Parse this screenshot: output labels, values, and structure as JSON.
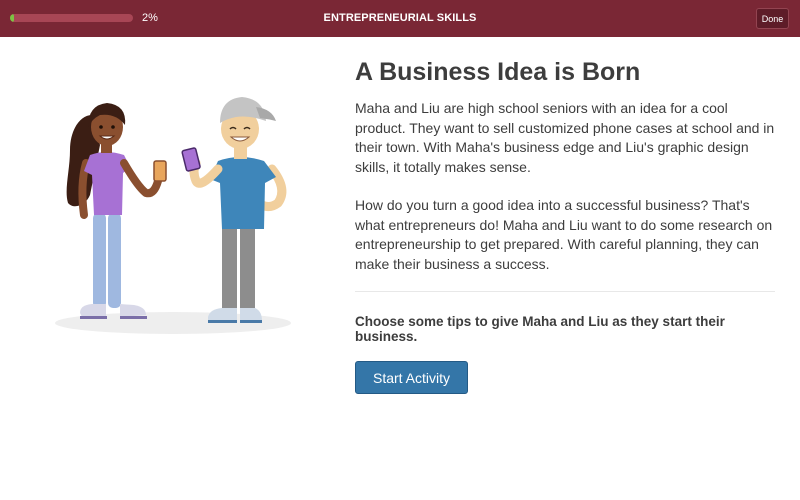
{
  "header": {
    "progress_percent_label": "2%",
    "progress_fraction": 0.02,
    "title": "ENTREPRENEURIAL SKILLS",
    "done_label": "Done"
  },
  "main": {
    "heading": "A Business Idea is Born",
    "paragraph1": "Maha and Liu are high school seniors with an idea for a cool product. They want to sell customized phone cases at school and in their town. With Maha's business edge and Liu's graphic design skills, it totally makes sense.",
    "paragraph2": "How do you turn a good idea into a successful business? That's what entrepreneurs do! Maha and Liu want to do some research on entrepreneurship to get prepared. With careful planning, they can make their business a success.",
    "prompt": "Choose some tips to give Maha and Liu as they start their business.",
    "start_label": "Start Activity"
  },
  "colors": {
    "header_bg": "#7a2735",
    "progress_fill": "#7cc243",
    "button_bg": "#3476a8"
  }
}
